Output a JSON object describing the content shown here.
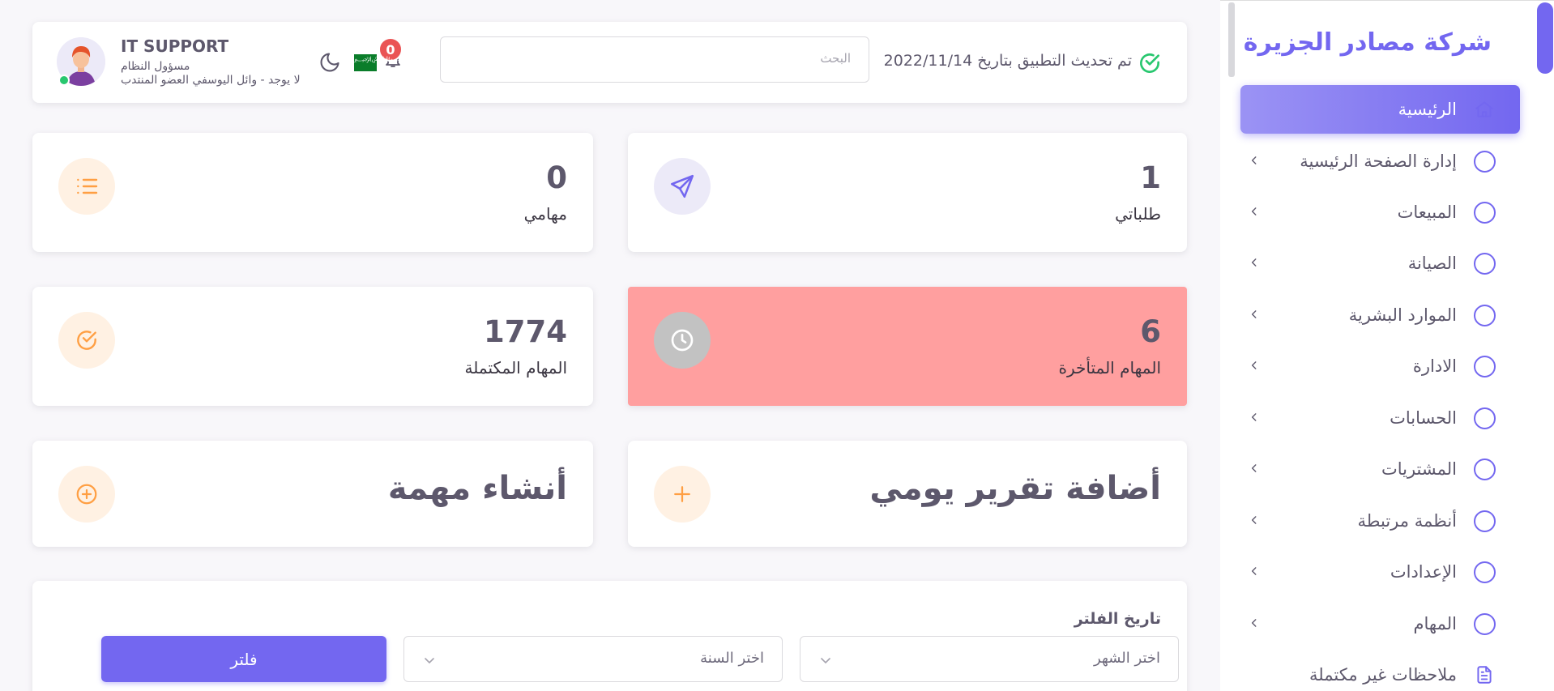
{
  "sidebar": {
    "brand": "شركة مصادر الجزيرة",
    "items": [
      {
        "label": "الرئيسية",
        "icon": "home-icon",
        "active": true
      },
      {
        "label": "إدارة الصفحة الرئيسية",
        "icon": "circle-icon"
      },
      {
        "label": "المبيعات",
        "icon": "circle-icon"
      },
      {
        "label": "الصيانة",
        "icon": "circle-icon"
      },
      {
        "label": "الموارد البشرية",
        "icon": "circle-icon"
      },
      {
        "label": "الادارة",
        "icon": "circle-icon"
      },
      {
        "label": "الحسابات",
        "icon": "circle-icon"
      },
      {
        "label": "المشتريات",
        "icon": "circle-icon"
      },
      {
        "label": "أنظمة مرتبطة",
        "icon": "circle-icon"
      },
      {
        "label": "الإعدادات",
        "icon": "circle-icon"
      },
      {
        "label": "المهام",
        "icon": "circle-icon"
      },
      {
        "label": "ملاحظات غير مكتملة",
        "icon": "document-icon"
      }
    ]
  },
  "header": {
    "update_text": "تم تحديث التطبيق بتاريخ 2022/11/14",
    "search_placeholder": "البحث",
    "notification_count": "0",
    "flag_text": "﷽",
    "user": {
      "name": "IT SUPPORT",
      "role": "مسؤول النظام",
      "subtitle": "لا يوجد - وائل اليوسفي العضو المنتدب"
    }
  },
  "stats": {
    "my_requests": {
      "value": "1",
      "label": "طلباتي"
    },
    "my_tasks": {
      "value": "0",
      "label": "مهامي"
    },
    "late_tasks": {
      "value": "6",
      "label": "المهام المتأخرة"
    },
    "completed_tasks": {
      "value": "1774",
      "label": "المهام المكتملة"
    }
  },
  "actions": {
    "add_daily_report": "أضافة تقرير يومي",
    "create_task": "أنشاء مهمة"
  },
  "filter": {
    "title": "تاريخ الفلتر",
    "month_placeholder": "اختر الشهر",
    "year_placeholder": "اختر السنة",
    "button": "فلتر"
  },
  "colors": {
    "primary": "#7367f0",
    "danger_card": "#ff9f9f",
    "warning": "#ff9f43",
    "success": "#28c76f"
  }
}
